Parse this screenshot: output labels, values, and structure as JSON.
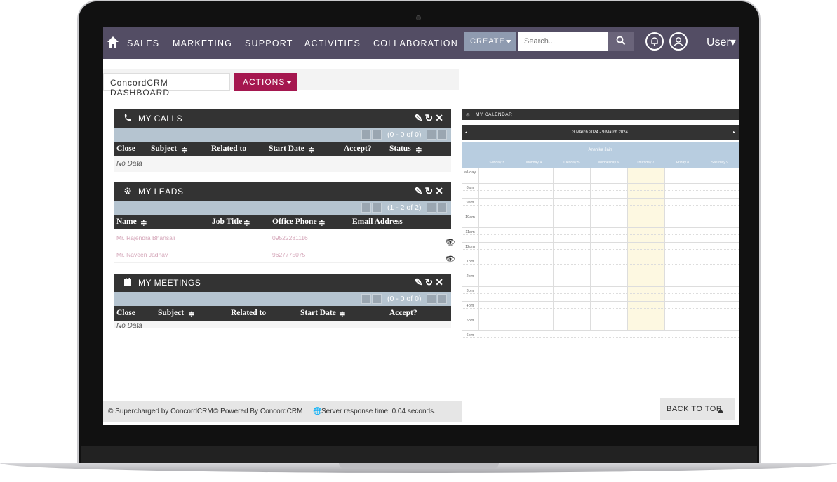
{
  "nav": {
    "items": [
      "SALES",
      "MARKETING",
      "SUPPORT",
      "ACTIVITIES",
      "COLLABORATION"
    ],
    "create_label": "CREATE",
    "search_placeholder": "Search...",
    "user_label": "User"
  },
  "tabs": {
    "dashboard_label": "ConcordCRM DASHBOARD",
    "actions_label": "ACTIONS"
  },
  "calls": {
    "title": "MY CALLS",
    "pager": "(0 - 0 of 0)",
    "columns": [
      "Close",
      "Subject",
      "Related to",
      "Start Date",
      "Accept?",
      "Status"
    ],
    "empty": "No Data"
  },
  "leads": {
    "title": "MY LEADS",
    "pager": "(1 - 2 of 2)",
    "columns": [
      "Name",
      "Job Title",
      "Office Phone",
      "Email Address"
    ],
    "rows": [
      {
        "name": "Mr. Rajendra Bhansali",
        "phone": "09522281116"
      },
      {
        "name": "Mr. Naveen Jadhav",
        "phone": "9627775075"
      }
    ]
  },
  "meetings": {
    "title": "MY MEETINGS",
    "pager": "(0 - 0 of 0)",
    "columns": [
      "Close",
      "Subject",
      "Related to",
      "Start Date",
      "Accept?"
    ],
    "empty": "No Data"
  },
  "calendar": {
    "title": "MY CALENDAR",
    "range": "3 March 2024 - 9 March 2024",
    "person": "Anshika Jain",
    "days": [
      "Sunday 3",
      "Monday 4",
      "Tuesday 5",
      "Wednesday 6",
      "Thursday 7",
      "Friday 8",
      "Saturday 9"
    ],
    "hours": [
      "all-day",
      "8am",
      "9am",
      "10am",
      "11am",
      "12pm",
      "1pm",
      "2pm",
      "3pm",
      "4pm",
      "5pm",
      "6pm"
    ]
  },
  "footer": {
    "supercharged": "© Supercharged by ConcordCRM",
    "powered": "© Powered By ConcordCRM",
    "response": "Server response time: 0.04 seconds."
  },
  "back_to_top": "BACK TO TOP",
  "colors": {
    "nav_bg": "#534d64",
    "actions_accent": "#a5174f",
    "dashlet_header": "#333333",
    "pager_bg": "#b5c4d0",
    "calendar_today": "#fdf8e1"
  }
}
